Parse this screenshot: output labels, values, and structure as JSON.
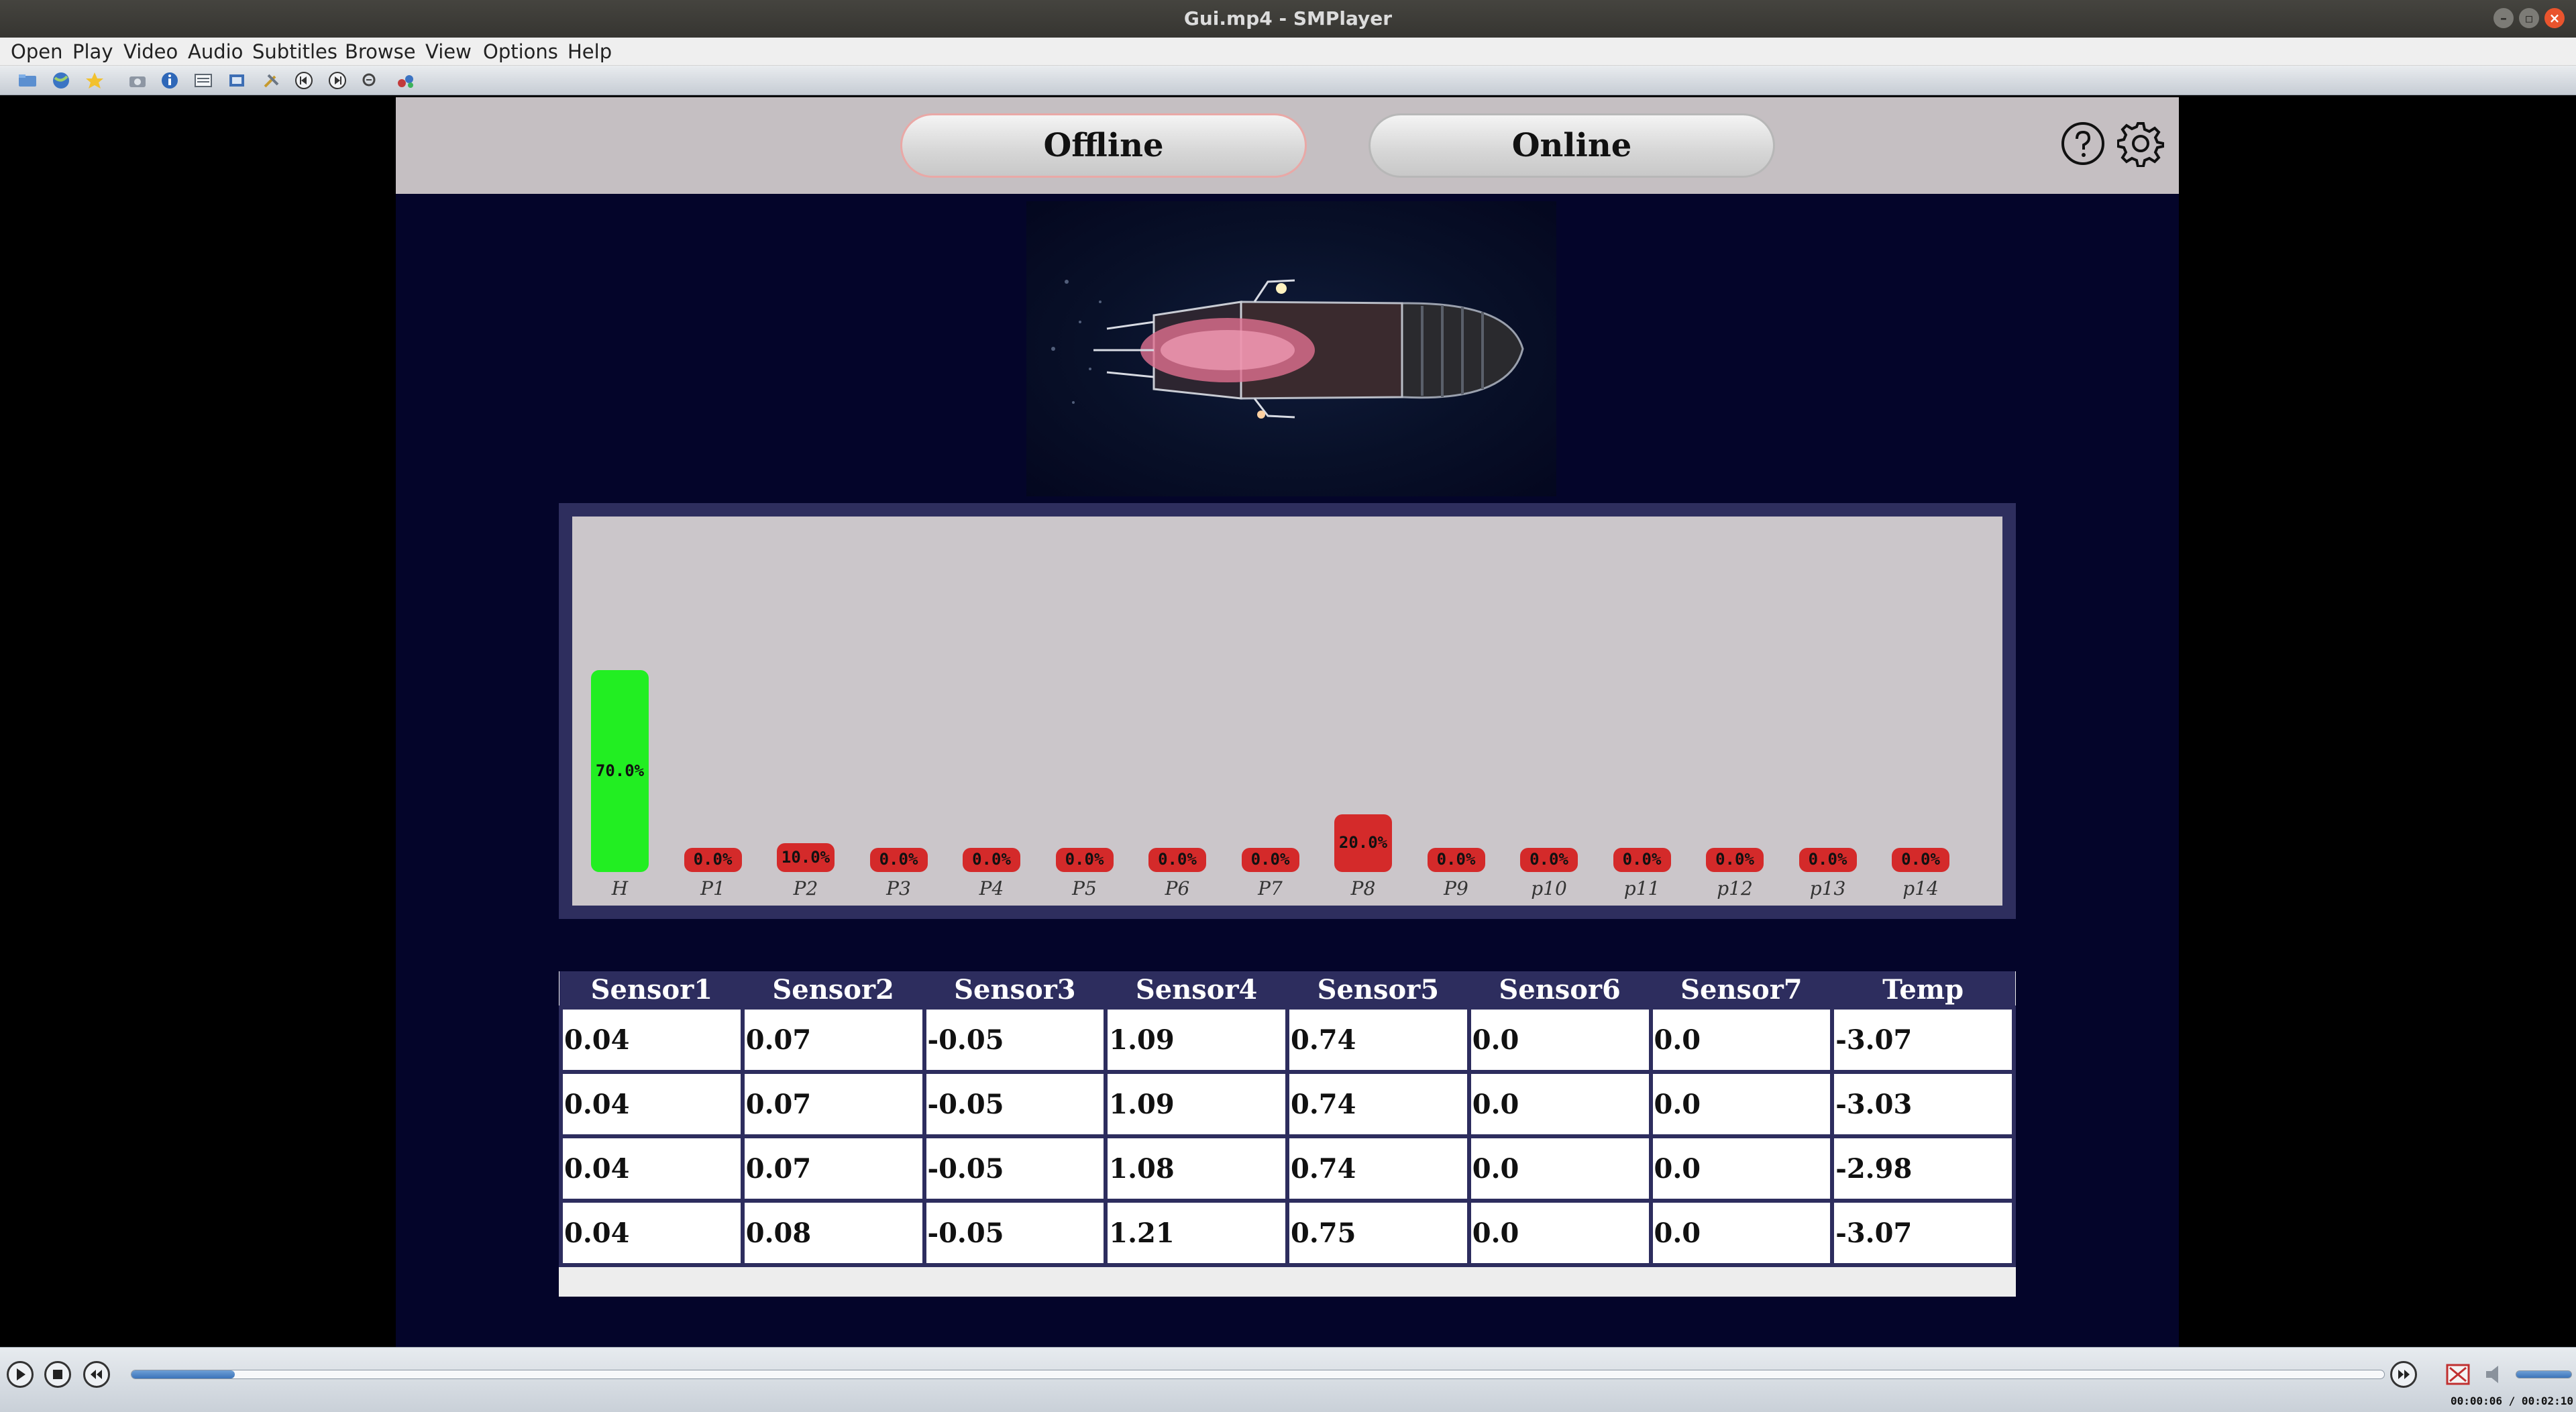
{
  "window": {
    "title": "Gui.mp4 - SMPlayer"
  },
  "menu": [
    "Open",
    "Play",
    "Video",
    "Audio",
    "Subtitles",
    "Browse",
    "View",
    "Options",
    "Help"
  ],
  "app": {
    "tabs": [
      {
        "label": "Offline",
        "active": true
      },
      {
        "label": "Online",
        "active": false
      }
    ],
    "help_icon": "question-icon",
    "settings_icon": "gear-icon"
  },
  "chart_data": {
    "type": "bar",
    "categories": [
      "H",
      "P1",
      "P2",
      "P3",
      "P4",
      "P5",
      "P6",
      "P7",
      "P8",
      "P9",
      "p10",
      "p11",
      "p12",
      "p13",
      "p14"
    ],
    "values": [
      70.0,
      0.0,
      10.0,
      0.0,
      0.0,
      0.0,
      0.0,
      0.0,
      20.0,
      0.0,
      0.0,
      0.0,
      0.0,
      0.0,
      0.0
    ],
    "value_labels": [
      "70.0%",
      "0.0%",
      "10.0%",
      "0.0%",
      "0.0%",
      "0.0%",
      "0.0%",
      "0.0%",
      "20.0%",
      "0.0%",
      "0.0%",
      "0.0%",
      "0.0%",
      "0.0%",
      "0.0%"
    ],
    "colors": [
      "#22ee22",
      "#d42a2a",
      "#d42a2a",
      "#d42a2a",
      "#d42a2a",
      "#d42a2a",
      "#d42a2a",
      "#d42a2a",
      "#d42a2a",
      "#d42a2a",
      "#d42a2a",
      "#d42a2a",
      "#d42a2a",
      "#d42a2a",
      "#d42a2a"
    ],
    "ylim": [
      0,
      100
    ],
    "grid": false,
    "legend": "none"
  },
  "table": {
    "headers": [
      "Sensor1",
      "Sensor2",
      "Sensor3",
      "Sensor4",
      "Sensor5",
      "Sensor6",
      "Sensor7",
      "Temp"
    ],
    "rows": [
      [
        "0.04",
        "0.07",
        "-0.05",
        "1.09",
        "0.74",
        "0.0",
        "0.0",
        "-3.07"
      ],
      [
        "0.04",
        "0.07",
        "-0.05",
        "1.09",
        "0.74",
        "0.0",
        "0.0",
        "-3.03"
      ],
      [
        "0.04",
        "0.07",
        "-0.05",
        "1.08",
        "0.74",
        "0.0",
        "0.0",
        "-2.98"
      ],
      [
        "0.04",
        "0.08",
        "-0.05",
        "1.21",
        "0.75",
        "0.0",
        "0.0",
        "-3.07"
      ]
    ]
  },
  "player": {
    "time": "00:00:06 / 00:02:10",
    "progress": 0.046
  }
}
